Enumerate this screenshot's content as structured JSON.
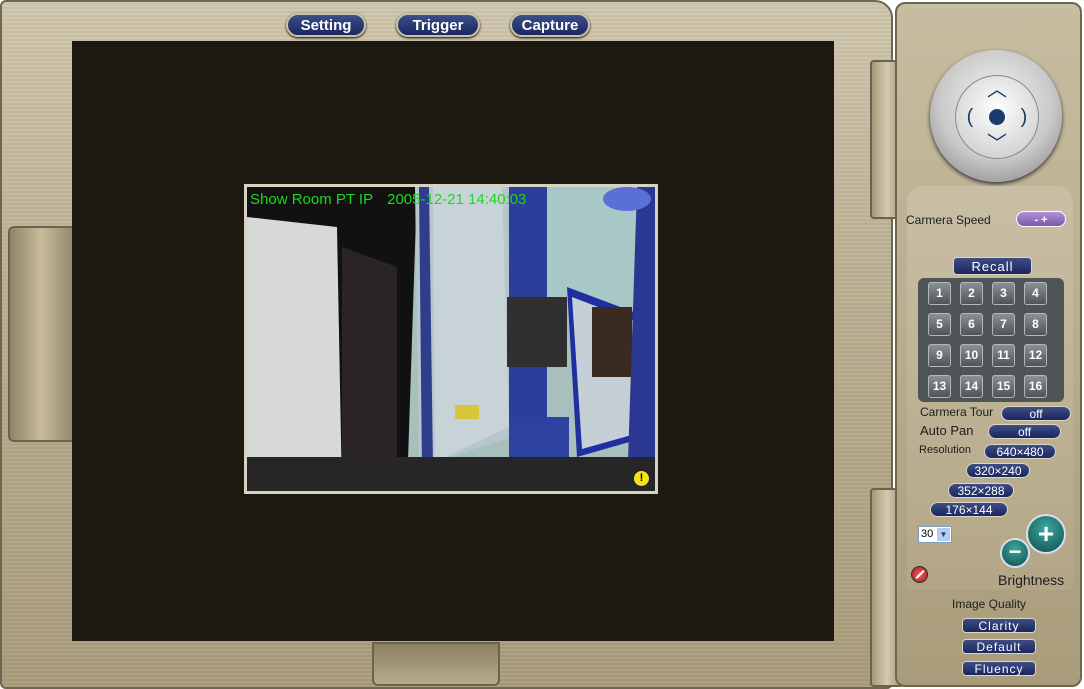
{
  "toolbar": {
    "setting_label": "Setting",
    "trigger_label": "Trigger",
    "capture_label": "Capture"
  },
  "video": {
    "camera_name": "Show Room PT IP",
    "timestamp": "2005-12-21 14:40:03",
    "alarm_symbol": "!"
  },
  "ptz": {
    "up_icon": "chevron-up-icon",
    "down_icon": "chevron-down-icon",
    "left_icon": "chevron-left-icon",
    "right_icon": "chevron-right-icon"
  },
  "controls": {
    "camera_speed_label": "Carmera Speed",
    "speed_buttons": "- +",
    "recall_label": "Recall",
    "presets": [
      "1",
      "2",
      "3",
      "4",
      "5",
      "6",
      "7",
      "8",
      "9",
      "10",
      "11",
      "12",
      "13",
      "14",
      "15",
      "16"
    ],
    "camera_tour_label": "Carmera Tour",
    "camera_tour_value": "off",
    "auto_pan_label": "Auto Pan",
    "auto_pan_value": "off",
    "resolution_label": "Resolution",
    "resolutions": [
      "640×480",
      "320×240",
      "352×288",
      "176×144"
    ],
    "fps_value": "30",
    "brightness_label": "Brightness",
    "brightness_plus": "+",
    "brightness_minus": "−"
  },
  "image_quality": {
    "label": "Image Quality",
    "clarity_label": "Clarity",
    "default_label": "Default",
    "fluency_label": "Fluency"
  },
  "colors": {
    "osd_text": "#1cd81c",
    "button_blue": "#1b2660",
    "speed_button": "#7b58aa",
    "frame_metal": "#b9ae90",
    "viewport_bg": "#1c1812"
  }
}
